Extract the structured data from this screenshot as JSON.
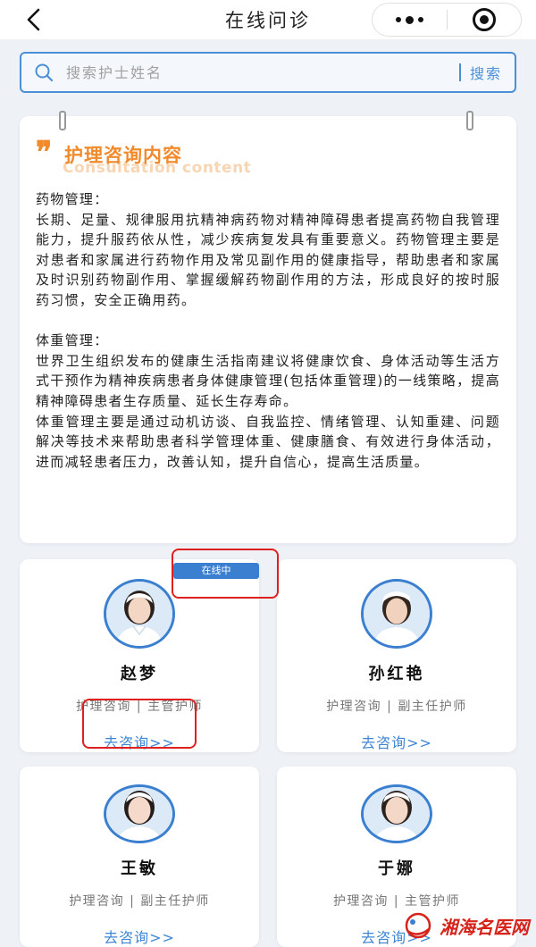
{
  "header": {
    "title": "在线问诊"
  },
  "search": {
    "placeholder": "搜索护士姓名",
    "button_label": "搜索"
  },
  "consult_content": {
    "title": "护理咨询内容",
    "subtitle": "Consultation content",
    "body": "药物管理：\n长期、足量、规律服用抗精神病药物对精神障碍患者提高药物自我管理能力，提升服药依从性，减少疾病复发具有重要意义。药物管理主要是对患者和家属进行药物作用及常见副作用的健康指导，帮助患者和家属及时识别药物副作用、掌握缓解药物副作用的方法，形成良好的按时服药习惯，安全正确用药。\n\n体重管理：\n世界卫生组织发布的健康生活指南建议将健康饮食、身体活动等生活方式干预作为精神疾病患者身体健康管理(包括体重管理)的一线策略，提高精神障碍患者生存质量、延长生存寿命。\n体重管理主要是通过动机访谈、自我监控、情绪管理、认知重建、问题解决等技术来帮助患者科学管理体重、健康膳食、有效进行身体活动，进而减轻患者压力，改善认知，提升自信心，提高生活质量。"
  },
  "status_badge": "在线中",
  "nurses": [
    {
      "name": "赵梦",
      "service": "护理咨询",
      "title": "主管护师",
      "action": "去咨询>>"
    },
    {
      "name": "孙红艳",
      "service": "护理咨询",
      "title": "副主任护师",
      "action": "去咨询>>"
    },
    {
      "name": "王敏",
      "service": "护理咨询",
      "title": "副主任护师",
      "action": "去咨询>>"
    },
    {
      "name": "于娜",
      "service": "护理咨询",
      "title": "主管护师",
      "action": "去咨询>>"
    }
  ],
  "nurse_meta_separator": "|",
  "watermark": "湘海名医网",
  "colors": {
    "accent_blue": "#3b7fd0",
    "accent_orange": "#f08a2c",
    "highlight_red": "#e02020"
  }
}
